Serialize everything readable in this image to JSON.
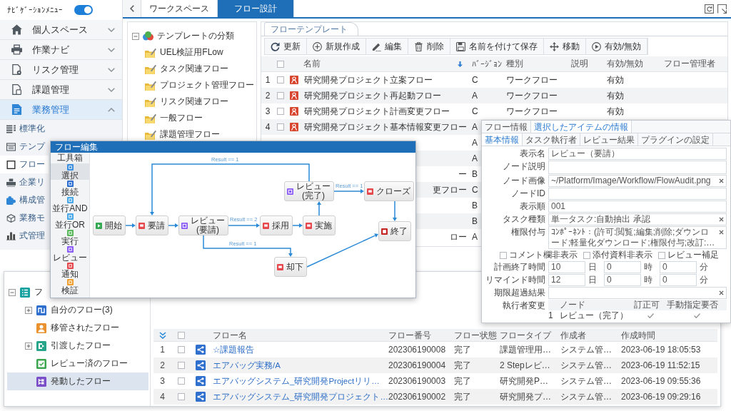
{
  "nav": {
    "title": "ﾅﾋﾞｹﾞｰｼｮﾝﾒﾆｭｰ",
    "toggle_on": true,
    "items": [
      {
        "label": "個人スペース",
        "selected": false,
        "expanded": false
      },
      {
        "label": "作業ナビ",
        "selected": false,
        "expanded": false
      },
      {
        "label": "リスク管理",
        "selected": false,
        "expanded": false
      },
      {
        "label": "課題管理",
        "selected": false,
        "expanded": false
      },
      {
        "label": "業務管理",
        "selected": true,
        "expanded": true,
        "children": [
          {
            "label": "標準化",
            "selected": false
          },
          {
            "label": "テンプ",
            "selected": false
          },
          {
            "label": "フロー",
            "selected": true
          },
          {
            "label": "企業リ",
            "selected": false
          },
          {
            "label": "構成管",
            "selected": false
          },
          {
            "label": "業務モ",
            "selected": false
          },
          {
            "label": "式管理",
            "selected": false
          }
        ]
      }
    ]
  },
  "tabs": [
    {
      "label": "ワークスペース",
      "selected": false
    },
    {
      "label": "フロー設計",
      "selected": true
    }
  ],
  "template_tree": {
    "label": "テンプレートの分類",
    "expanded": true,
    "children": [
      {
        "label": "UEL検証用FLow"
      },
      {
        "label": "タスク関連フロー"
      },
      {
        "label": "プロジェクト管理フロー"
      },
      {
        "label": "リスク関連フロー"
      },
      {
        "label": "一般フロー"
      },
      {
        "label": "課題管理フロー"
      }
    ]
  },
  "flow_templates": {
    "tab": "フローテンプレート",
    "toolbar": [
      "更新",
      "新規作成",
      "編集",
      "削除",
      "名前を付けて保存",
      "移動",
      "有効/無効"
    ],
    "select_all": false,
    "columns": [
      {
        "label": "名前",
        "sorted": true
      },
      {
        "label": "ﾊﾞｰｼﾞｮﾝ",
        "sorted": false
      },
      {
        "label": "種別",
        "sorted": false
      },
      {
        "label": "説明",
        "sorted": false
      },
      {
        "label": "有効/無効",
        "sorted": false
      },
      {
        "label": "フロー管理者",
        "sorted": false
      }
    ],
    "rows": [
      {
        "no": "1",
        "checked": false,
        "name": "研究開発プロジェクト立案フロー",
        "version": "C",
        "type": "ワークフロー",
        "enabled": "有効"
      },
      {
        "no": "2",
        "checked": false,
        "name": "研究開発プロジェクト再起動フロー",
        "version": "A",
        "type": "ワークフロー",
        "enabled": "有効"
      },
      {
        "no": "3",
        "checked": false,
        "name": "研究開発プロジェクト計画変更フロー",
        "version": "C",
        "type": "ワークフロー",
        "enabled": "有効"
      },
      {
        "no": "4",
        "checked": false,
        "name": "研究開発プロジェクト基本情報変更フロー",
        "version": "A"
      },
      {
        "version": "A"
      },
      {
        "version": "A"
      },
      {
        "name_tail": "ー",
        "version": "B"
      },
      {
        "name_tail": "更フロー",
        "version": "C"
      },
      {
        "version": "B"
      },
      {
        "version": "B"
      },
      {
        "name_tail": "ロー",
        "version": "A"
      }
    ]
  },
  "flow_tree": {
    "label": "フ",
    "expanded": true,
    "children": [
      {
        "label": "自分のフロー(3)",
        "expanded": false,
        "selected": false
      },
      {
        "label": "移管されたフロー",
        "selected": false
      },
      {
        "label": "引渡したフロー",
        "expanded": false,
        "selected": false
      },
      {
        "label": "レビュー済のフロー",
        "selected": false
      },
      {
        "label": "発動したフロー",
        "selected": true
      }
    ]
  },
  "flows": {
    "select_all": false,
    "columns": [
      "フロー名",
      "フロー番号",
      "フロー状態",
      "フロータイプ",
      "作成者",
      "作成時間"
    ],
    "rows": [
      {
        "no": "1",
        "checked": false,
        "name": "☆課題報告",
        "number": "202306190008",
        "state": "完了",
        "type": "課題管理用…",
        "creator": "システム管…",
        "created": "2023-06-19 18:05:53"
      },
      {
        "no": "2",
        "checked": false,
        "name": "エアバッグ実務/A",
        "number": "202306190004",
        "state": "完了",
        "type": "2 Stepレビ…",
        "creator": "システム管…",
        "created": "2023-06-19 11:52:15"
      },
      {
        "no": "3",
        "checked": false,
        "name": "エアバッグシステム_研究開発Projectリリ…",
        "number": "202306190003",
        "state": "完了",
        "type": "研究開発P…",
        "creator": "システム管…",
        "created": "2023-06-19 09:55:36"
      },
      {
        "no": "4",
        "checked": false,
        "name": "エアバッグシステム_研究開発プロジェクト…",
        "number": "202306190002",
        "state": "完了",
        "type": "研究開発プ…",
        "creator": "システム管…",
        "created": "2023-06-19 09:29:16"
      }
    ]
  },
  "flow_editor": {
    "title": "フロー編集",
    "toolbox_title": "工具箱",
    "tools": [
      {
        "label": "選択",
        "selected": true
      },
      {
        "label": "接続",
        "selected": false
      },
      {
        "label": "並行AND",
        "selected": false
      },
      {
        "label": "並行OR",
        "selected": false
      },
      {
        "label": "実行",
        "selected": false
      },
      {
        "label": "レビュー",
        "selected": false
      },
      {
        "label": "通知",
        "selected": false
      },
      {
        "label": "検証",
        "selected": false
      }
    ],
    "nodes": [
      {
        "kind": "start",
        "label": "開始"
      },
      {
        "kind": "task",
        "label": "要請"
      },
      {
        "kind": "review",
        "label": "レビュー(要請)"
      },
      {
        "kind": "task",
        "label": "採用"
      },
      {
        "kind": "task",
        "label": "実施"
      },
      {
        "kind": "review",
        "label": "レビュー(完了)"
      },
      {
        "kind": "task",
        "label": "クローズ"
      },
      {
        "kind": "task",
        "label": "却下"
      },
      {
        "kind": "end",
        "label": "終了"
      }
    ],
    "edge_labels": [
      "Result == 1",
      "Result == 2",
      "Result == 1",
      "Result == 1"
    ]
  },
  "node_properties": {
    "tabs": [
      {
        "label": "フロー情報",
        "selected": false
      },
      {
        "label": "選択したアイテムの情報",
        "selected": true
      }
    ],
    "subtabs": [
      {
        "label": "基本情報",
        "selected": true
      },
      {
        "label": "タスク執行者",
        "selected": false
      },
      {
        "label": "レビュー結果",
        "selected": false
      },
      {
        "label": "プラグインの設定",
        "selected": false
      }
    ],
    "fields": [
      {
        "kind": "text",
        "label": "表示名",
        "value": "レビュー（要請）",
        "clearable": false
      },
      {
        "kind": "textarea",
        "label": "ノード説明",
        "clearable": false
      },
      {
        "kind": "text",
        "label": "ノード画像",
        "value": "~/Platform/Image/Workflow/FlowAudit.png",
        "clearable": true
      },
      {
        "kind": "text",
        "label": "ノードID",
        "clearable": false
      },
      {
        "kind": "text",
        "label": "表示順",
        "value": "001",
        "clearable": false
      },
      {
        "kind": "text",
        "label": "タスク種類",
        "value": "単一タスク:自動抽出 承認",
        "clearable": true
      },
      {
        "kind": "text",
        "label": "権限付与",
        "value": "ｺﾝﾎﾟｰﾈﾝﾄ：(許可:閲覧;編集;削除;ダウンロード;軽量化ダウンロード;権限付与;改訂:…",
        "clearable": true
      },
      {
        "kind": "checks",
        "options": [
          {
            "label": "コメント欄非表示",
            "checked": false
          },
          {
            "label": "添付資料非表示",
            "checked": false
          },
          {
            "label": "レビュー補足",
            "checked": false
          }
        ]
      },
      {
        "kind": "duration",
        "label": "計画終了時間",
        "parts": [
          {
            "value": "10",
            "unit": "日"
          },
          {
            "value": "0",
            "unit": "時"
          },
          {
            "value": "0",
            "unit": "分"
          }
        ]
      },
      {
        "kind": "duration",
        "label": "リマインド時間",
        "parts": [
          {
            "value": "12",
            "unit": "日"
          },
          {
            "value": "0",
            "unit": "時"
          },
          {
            "value": "0",
            "unit": "分"
          }
        ]
      },
      {
        "kind": "text",
        "label": "期限超過結果",
        "clearable": true
      },
      {
        "kind": "table",
        "label": "執行者変更",
        "columns": [
          "ノード",
          "訂正可",
          "手動指定要否"
        ],
        "rows": [
          {
            "no": "1",
            "node": "レビュー（完了）",
            "correctable": true,
            "manual": true
          }
        ]
      }
    ]
  }
}
